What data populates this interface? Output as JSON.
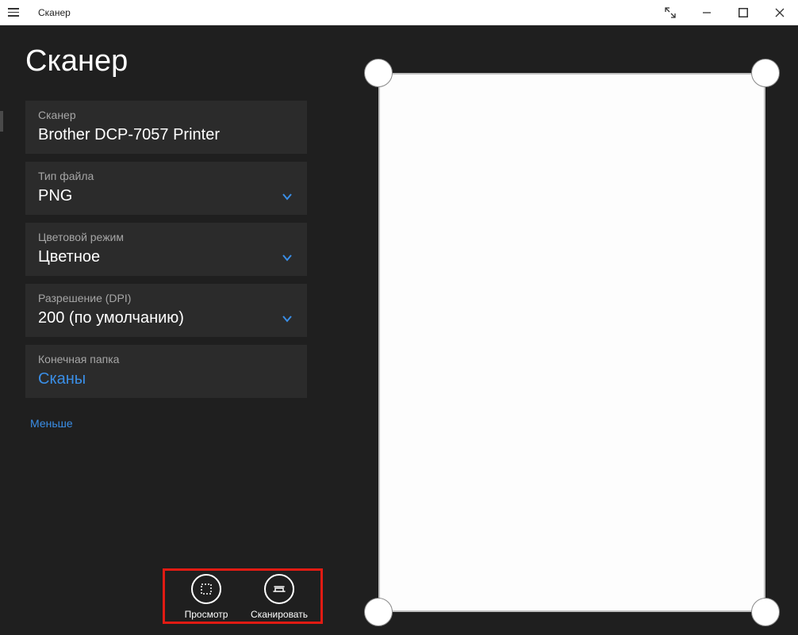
{
  "window": {
    "title": "Сканер"
  },
  "page": {
    "title": "Сканер"
  },
  "settings": {
    "scanner": {
      "label": "Сканер",
      "value": "Brother DCP-7057 Printer"
    },
    "filetype": {
      "label": "Тип файла",
      "value": "PNG"
    },
    "colormode": {
      "label": "Цветовой режим",
      "value": "Цветное"
    },
    "dpi": {
      "label": "Разрешение (DPI)",
      "value": "200 (по умолчанию)"
    },
    "folder": {
      "label": "Конечная папка",
      "value": "Сканы"
    }
  },
  "links": {
    "less": "Меньше"
  },
  "actions": {
    "preview": "Просмотр",
    "scan": "Сканировать"
  }
}
